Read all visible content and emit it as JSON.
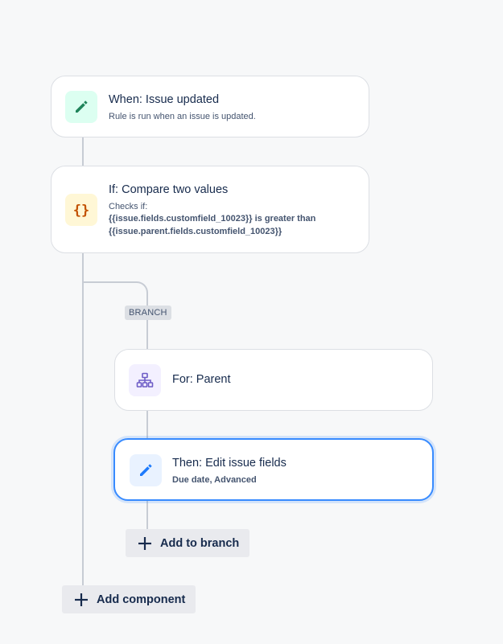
{
  "trigger": {
    "title": "When: Issue updated",
    "subtitle": "Rule is run when an issue is updated.",
    "icon": "pencil-icon"
  },
  "condition": {
    "title": "If: Compare two values",
    "checks_label": "Checks if:",
    "expression_line1": "{{issue.fields.customfield_10023}} is greater than",
    "expression_line2": "{{issue.parent.fields.customfield_10023}}",
    "icon": "braces-icon"
  },
  "branch": {
    "label": "BRANCH",
    "for_card": {
      "title": "For: Parent",
      "icon": "hierarchy-icon"
    },
    "action_card": {
      "title": "Then: Edit issue fields",
      "subtitle": "Due date, Advanced",
      "icon": "pencil-icon"
    },
    "add_button_label": "Add to branch"
  },
  "add_component_label": "Add component",
  "colors": {
    "background": "#f7f8f9",
    "selected_border": "#388bff",
    "connector": "#c7ccd4"
  }
}
